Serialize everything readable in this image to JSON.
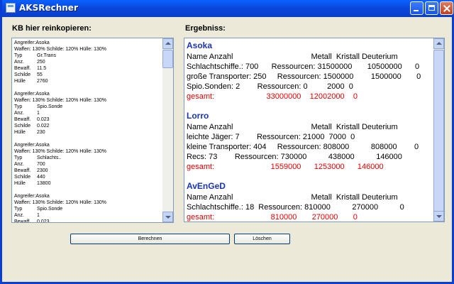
{
  "window": {
    "title": "AKSRechner"
  },
  "labels": {
    "input": "KB hier reinkopieren:",
    "output": "Ergebniss:"
  },
  "input_blocks": [
    {
      "attacker": "Angreifer:Asoka",
      "weapons": "Waffen: 130% Schilde: 120% Hülle: 130%",
      "rows": [
        {
          "k": "Typ",
          "v": "Gr.Trans"
        },
        {
          "k": "Anz.",
          "v": "250"
        },
        {
          "k": "Bewaff.",
          "v": "11.5"
        },
        {
          "k": "Schilde",
          "v": "55"
        },
        {
          "k": "Hülle",
          "v": "2760"
        }
      ]
    },
    {
      "attacker": "Angreifer:Asoka",
      "weapons": "Waffen: 130% Schilde: 120% Hülle: 130%",
      "rows": [
        {
          "k": "Typ",
          "v": "Spio.Sonde"
        },
        {
          "k": "Anz.",
          "v": "1"
        },
        {
          "k": "Bewaff.",
          "v": "0.023"
        },
        {
          "k": "Schilde",
          "v": "0.022"
        },
        {
          "k": "Hülle",
          "v": "230"
        }
      ]
    },
    {
      "attacker": "Angreifer:Asoka",
      "weapons": "Waffen: 130% Schilde: 120% Hülle: 130%",
      "rows": [
        {
          "k": "Typ",
          "v": "Schlachts.."
        },
        {
          "k": "Anz.",
          "v": "700"
        },
        {
          "k": "Bewaff.",
          "v": "2300"
        },
        {
          "k": "Schilde",
          "v": "440"
        },
        {
          "k": "Hülle",
          "v": "13800"
        }
      ]
    },
    {
      "attacker": "Angreifer:Asoka",
      "weapons": "Waffen: 130% Schilde: 120% Hülle: 130%",
      "rows": [
        {
          "k": "Typ",
          "v": "Spio.Sonde"
        },
        {
          "k": "Anz.",
          "v": "1"
        },
        {
          "k": "Bewaff.",
          "v": "0.023"
        }
      ]
    }
  ],
  "results": [
    {
      "player": "Asoka",
      "header": "Name Anzahl                                    Metall  Kristall Deuterium",
      "lines": [
        "Schlachtschiffe.: 700      Ressourcen: 31500000       10500000      0",
        "große Transporter: 250     Ressourcen: 1500000        1500000       0",
        "Spio.Sonden: 2        Ressourcen: 0         2000  0"
      ],
      "total_label": "gesamt:",
      "total": "                        33000000    12002000    0"
    },
    {
      "player": "Lorro",
      "header": "Name Anzahl                                    Metall  Kristall Deuterium",
      "lines": [
        "leichte Jäger: 7        Ressourcen: 21000  7000  0",
        "kleine Transporter: 404     Ressourcen: 808000          808000        0",
        "Recs: 73        Ressourcen: 730000          438000          146000"
      ],
      "total_label": "gesamt:",
      "total": "                          1559000      1253000      146000"
    },
    {
      "player": "AvEnGeD",
      "header": "Name Anzahl                                    Metall  Kristall Deuterium",
      "lines": [
        "Schlachtschiffe.: 18  Ressourcen: 810000          270000          0"
      ],
      "total_label": "gesamt:",
      "total": "                          810000       270000       0"
    }
  ],
  "buttons": {
    "calculate": "Berechnen",
    "clear": "Löschen"
  }
}
